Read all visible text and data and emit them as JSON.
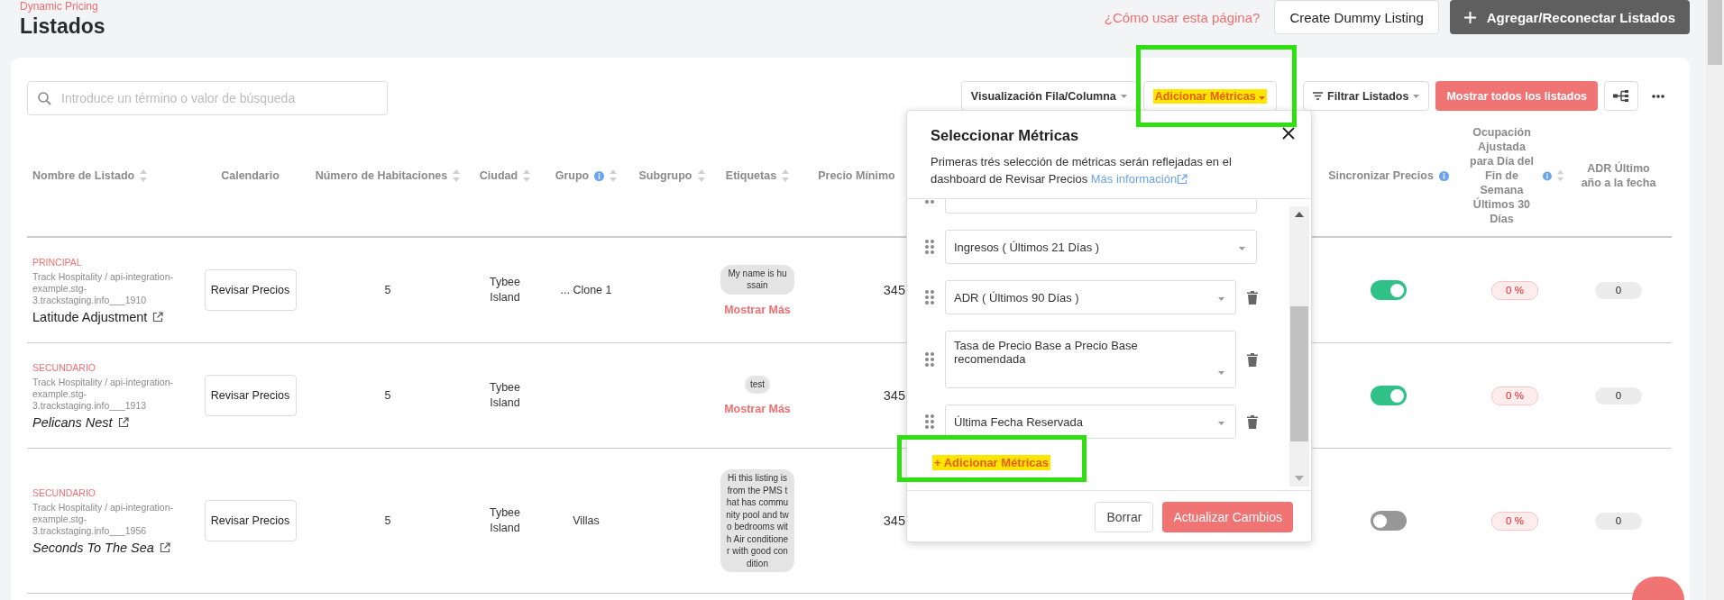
{
  "breadcrumb": "Dynamic Pricing",
  "title": "Listados",
  "help_link": "¿Cómo usar esta página?",
  "header_buttons": [
    {
      "label": "Create Dummy Listing",
      "kind": "outline"
    },
    {
      "label": "Agregar/Reconectar Listados",
      "kind": "dark"
    }
  ],
  "search": {
    "placeholder": "Introduce un término o valor de búsqueda"
  },
  "toolbar": {
    "view_toggle": "Visualización Fila/Columna",
    "metrics_button": {
      "label": "Adicionar Métricas",
      "highlighted": true
    },
    "filter": "Filtrar Listados",
    "show_all": "Mostrar todos los listados"
  },
  "table": {
    "columns": [
      {
        "label": "Nombre de Listado",
        "sortable": true,
        "info": false
      },
      {
        "label": "Calendario",
        "sortable": false,
        "info": false
      },
      {
        "label": "Número de Habitaciones",
        "sortable": true,
        "info": false
      },
      {
        "label": "Ciudad",
        "sortable": true,
        "info": false
      },
      {
        "label": "Grupo",
        "sortable": true,
        "info": true
      },
      {
        "label": "Subgrupo",
        "sortable": true,
        "info": false
      },
      {
        "label": "Etiquetas",
        "sortable": true,
        "info": false
      },
      {
        "label": "Precio Mínimo",
        "sortable": false,
        "info": false
      },
      {
        "label": "Sincronizar Precios",
        "sortable": false,
        "info": true
      },
      {
        "label": "Ocupación Ajustada para Día del Fin de Semana Últimos 30 Días",
        "sortable": true,
        "info": true
      },
      {
        "label": "ADR Último año a la fecha",
        "sortable": false,
        "info": false
      }
    ],
    "rows": [
      {
        "role": "PRINCIPAL",
        "source": "Track Hospitality / api-integration-example.stg-3.trackstaging.info___1910",
        "name": "Latitude Adjustment",
        "italic": false,
        "review": "Revisar Precios",
        "rooms": "5",
        "city": "Tybee Island",
        "group": "... Clone 1",
        "subgroup": "",
        "tag": "My name is hussain",
        "show_more": "Mostrar Más",
        "min_price": "345",
        "sync": true,
        "occupancy": "0 %",
        "adr": "0"
      },
      {
        "role": "SECUNDARIO",
        "source": "Track Hospitality / api-integration-example.stg-3.trackstaging.info___1913",
        "name": "Pelicans Nest",
        "italic": true,
        "review": "Revisar Precios",
        "rooms": "5",
        "city": "Tybee Island",
        "group": "",
        "subgroup": "",
        "tag": "test",
        "show_more": "Mostrar Más",
        "min_price": "345",
        "sync": true,
        "occupancy": "0 %",
        "adr": "0"
      },
      {
        "role": "SECUNDARIO",
        "source": "Track Hospitality / api-integration-example.stg-3.trackstaging.info___1956",
        "name": "Seconds To The Sea",
        "italic": true,
        "review": "Revisar Precios",
        "rooms": "5",
        "city": "Tybee Island",
        "group": "Villas",
        "subgroup": "",
        "tag": "Hi this listing is from the PMS that has community pool and two bedrooms with Air conditioner with good condition",
        "show_more": "",
        "min_price": "345",
        "sync": false,
        "occupancy": "0 %",
        "adr": "0"
      }
    ]
  },
  "modal": {
    "title": "Seleccionar Métricas",
    "description": "Primeras trés selección de métricas serán reflejadas en el dashboard de Revisar Precios",
    "link": "Más información",
    "metrics": [
      {
        "label": "Ingresos ( Últimos 21 Días )",
        "removable": false
      },
      {
        "label": "ADR ( Últimos 90 Días )",
        "removable": true
      },
      {
        "label": "Tasa de Precio Base a Precio Base recomendada",
        "removable": true
      },
      {
        "label": "Última Fecha Reservada",
        "removable": true
      }
    ],
    "add_metrics": {
      "label": "+ Adicionar Métricas",
      "highlighted": true
    },
    "buttons": [
      {
        "label": "Borrar",
        "kind": "outline"
      },
      {
        "label": "Actualizar Cambios",
        "kind": "primary"
      }
    ]
  }
}
